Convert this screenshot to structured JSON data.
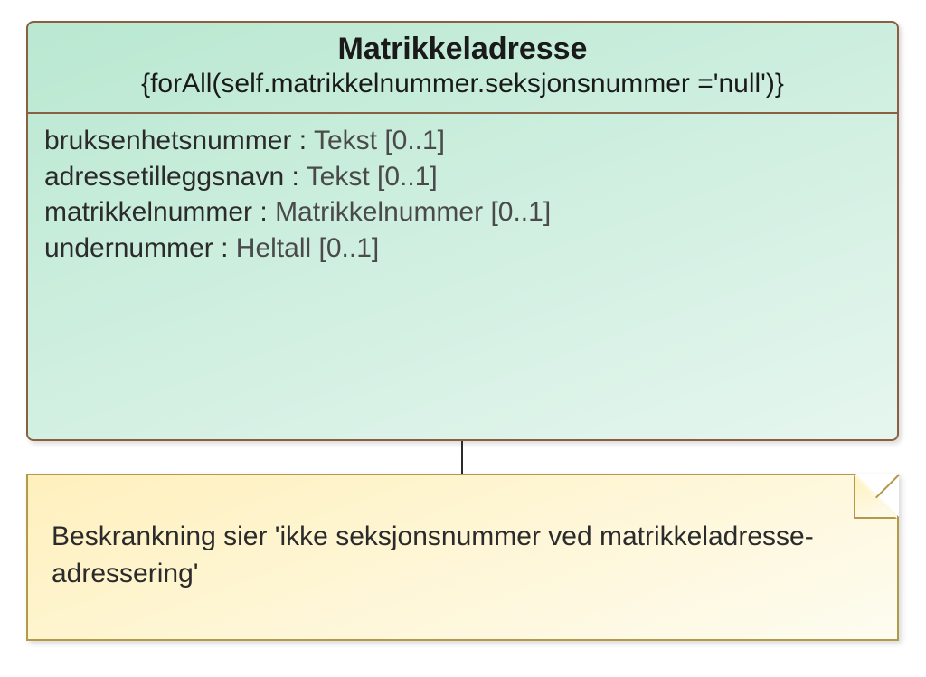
{
  "class": {
    "name": "Matrikkeladresse",
    "constraint": "{forAll(self.matrikkelnummer.seksjonsnummer ='null')}",
    "attributes": [
      {
        "name": "bruksenhetsnummer",
        "type": "Tekst",
        "multiplicity": "[0..1]"
      },
      {
        "name": "adressetilleggsnavn",
        "type": "Tekst",
        "multiplicity": "[0..1]"
      },
      {
        "name": "matrikkelnummer",
        "type": "Matrikkelnummer",
        "multiplicity": "[0..1]"
      },
      {
        "name": "undernummer",
        "type": "Heltall",
        "multiplicity": "[0..1]"
      }
    ]
  },
  "note": {
    "text": "Beskrankning sier 'ikke seksjonsnummer ved matrikkeladresse-adressering'"
  }
}
